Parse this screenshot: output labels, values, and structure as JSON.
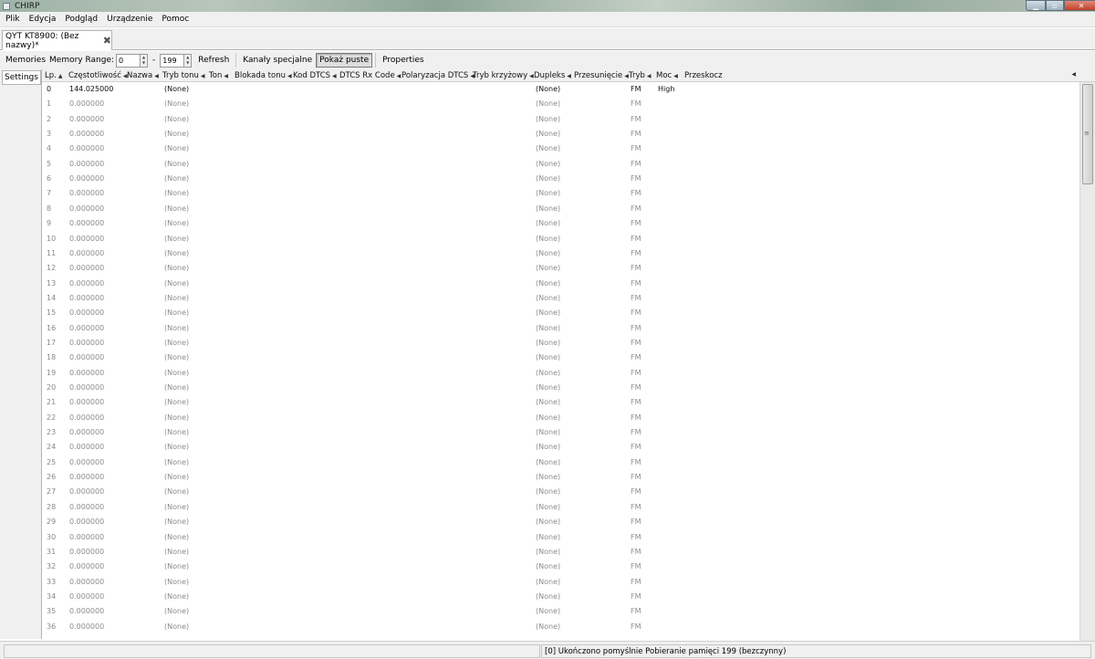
{
  "window": {
    "title": "CHIRP"
  },
  "menu": [
    "Plik",
    "Edycja",
    "Podgląd",
    "Urządzenie",
    "Pomoc"
  ],
  "doc_tab": {
    "label": "QYT KT8900: (Bez nazwy)*"
  },
  "toolbar": {
    "memories_label": "Memories",
    "memory_range_label": "Memory Range:",
    "range_start": "0",
    "range_sep": "-",
    "range_end": "199",
    "refresh": "Refresh",
    "special_channels": "Kanały specjalne",
    "show_empty": "Pokaż puste",
    "properties": "Properties"
  },
  "sidetab": {
    "label": "Settings"
  },
  "columns": [
    "Lp.",
    "Częstotliwość",
    "Nazwa",
    "Tryb tonu",
    "Ton",
    "Blokada tonu",
    "Kod DTCS",
    "DTCS Rx Code",
    "Polaryzacja DTCS",
    "Tryb krzyżowy",
    "Dupleks",
    "Przesunięcie",
    "Tryb",
    "Moc",
    "Przeskocz"
  ],
  "rows": [
    {
      "n": "0",
      "freq": "144.025000",
      "tone_mode": "(None)",
      "duplex": "(None)",
      "mode": "FM",
      "power": "High"
    },
    {
      "n": "1",
      "freq": "0.000000",
      "tone_mode": "(None)",
      "duplex": "(None)",
      "mode": "FM",
      "power": ""
    },
    {
      "n": "2",
      "freq": "0.000000",
      "tone_mode": "(None)",
      "duplex": "(None)",
      "mode": "FM",
      "power": ""
    },
    {
      "n": "3",
      "freq": "0.000000",
      "tone_mode": "(None)",
      "duplex": "(None)",
      "mode": "FM",
      "power": ""
    },
    {
      "n": "4",
      "freq": "0.000000",
      "tone_mode": "(None)",
      "duplex": "(None)",
      "mode": "FM",
      "power": ""
    },
    {
      "n": "5",
      "freq": "0.000000",
      "tone_mode": "(None)",
      "duplex": "(None)",
      "mode": "FM",
      "power": ""
    },
    {
      "n": "6",
      "freq": "0.000000",
      "tone_mode": "(None)",
      "duplex": "(None)",
      "mode": "FM",
      "power": ""
    },
    {
      "n": "7",
      "freq": "0.000000",
      "tone_mode": "(None)",
      "duplex": "(None)",
      "mode": "FM",
      "power": ""
    },
    {
      "n": "8",
      "freq": "0.000000",
      "tone_mode": "(None)",
      "duplex": "(None)",
      "mode": "FM",
      "power": ""
    },
    {
      "n": "9",
      "freq": "0.000000",
      "tone_mode": "(None)",
      "duplex": "(None)",
      "mode": "FM",
      "power": ""
    },
    {
      "n": "10",
      "freq": "0.000000",
      "tone_mode": "(None)",
      "duplex": "(None)",
      "mode": "FM",
      "power": ""
    },
    {
      "n": "11",
      "freq": "0.000000",
      "tone_mode": "(None)",
      "duplex": "(None)",
      "mode": "FM",
      "power": ""
    },
    {
      "n": "12",
      "freq": "0.000000",
      "tone_mode": "(None)",
      "duplex": "(None)",
      "mode": "FM",
      "power": ""
    },
    {
      "n": "13",
      "freq": "0.000000",
      "tone_mode": "(None)",
      "duplex": "(None)",
      "mode": "FM",
      "power": ""
    },
    {
      "n": "14",
      "freq": "0.000000",
      "tone_mode": "(None)",
      "duplex": "(None)",
      "mode": "FM",
      "power": ""
    },
    {
      "n": "15",
      "freq": "0.000000",
      "tone_mode": "(None)",
      "duplex": "(None)",
      "mode": "FM",
      "power": ""
    },
    {
      "n": "16",
      "freq": "0.000000",
      "tone_mode": "(None)",
      "duplex": "(None)",
      "mode": "FM",
      "power": ""
    },
    {
      "n": "17",
      "freq": "0.000000",
      "tone_mode": "(None)",
      "duplex": "(None)",
      "mode": "FM",
      "power": ""
    },
    {
      "n": "18",
      "freq": "0.000000",
      "tone_mode": "(None)",
      "duplex": "(None)",
      "mode": "FM",
      "power": ""
    },
    {
      "n": "19",
      "freq": "0.000000",
      "tone_mode": "(None)",
      "duplex": "(None)",
      "mode": "FM",
      "power": ""
    },
    {
      "n": "20",
      "freq": "0.000000",
      "tone_mode": "(None)",
      "duplex": "(None)",
      "mode": "FM",
      "power": ""
    },
    {
      "n": "21",
      "freq": "0.000000",
      "tone_mode": "(None)",
      "duplex": "(None)",
      "mode": "FM",
      "power": ""
    },
    {
      "n": "22",
      "freq": "0.000000",
      "tone_mode": "(None)",
      "duplex": "(None)",
      "mode": "FM",
      "power": ""
    },
    {
      "n": "23",
      "freq": "0.000000",
      "tone_mode": "(None)",
      "duplex": "(None)",
      "mode": "FM",
      "power": ""
    },
    {
      "n": "24",
      "freq": "0.000000",
      "tone_mode": "(None)",
      "duplex": "(None)",
      "mode": "FM",
      "power": ""
    },
    {
      "n": "25",
      "freq": "0.000000",
      "tone_mode": "(None)",
      "duplex": "(None)",
      "mode": "FM",
      "power": ""
    },
    {
      "n": "26",
      "freq": "0.000000",
      "tone_mode": "(None)",
      "duplex": "(None)",
      "mode": "FM",
      "power": ""
    },
    {
      "n": "27",
      "freq": "0.000000",
      "tone_mode": "(None)",
      "duplex": "(None)",
      "mode": "FM",
      "power": ""
    },
    {
      "n": "28",
      "freq": "0.000000",
      "tone_mode": "(None)",
      "duplex": "(None)",
      "mode": "FM",
      "power": ""
    },
    {
      "n": "29",
      "freq": "0.000000",
      "tone_mode": "(None)",
      "duplex": "(None)",
      "mode": "FM",
      "power": ""
    },
    {
      "n": "30",
      "freq": "0.000000",
      "tone_mode": "(None)",
      "duplex": "(None)",
      "mode": "FM",
      "power": ""
    },
    {
      "n": "31",
      "freq": "0.000000",
      "tone_mode": "(None)",
      "duplex": "(None)",
      "mode": "FM",
      "power": ""
    },
    {
      "n": "32",
      "freq": "0.000000",
      "tone_mode": "(None)",
      "duplex": "(None)",
      "mode": "FM",
      "power": ""
    },
    {
      "n": "33",
      "freq": "0.000000",
      "tone_mode": "(None)",
      "duplex": "(None)",
      "mode": "FM",
      "power": ""
    },
    {
      "n": "34",
      "freq": "0.000000",
      "tone_mode": "(None)",
      "duplex": "(None)",
      "mode": "FM",
      "power": ""
    },
    {
      "n": "35",
      "freq": "0.000000",
      "tone_mode": "(None)",
      "duplex": "(None)",
      "mode": "FM",
      "power": ""
    },
    {
      "n": "36",
      "freq": "0.000000",
      "tone_mode": "(None)",
      "duplex": "(None)",
      "mode": "FM",
      "power": ""
    }
  ],
  "status": {
    "message": "[0] Ukończono pomyślnie Pobieranie pamięci 199 (bezczynny)"
  }
}
